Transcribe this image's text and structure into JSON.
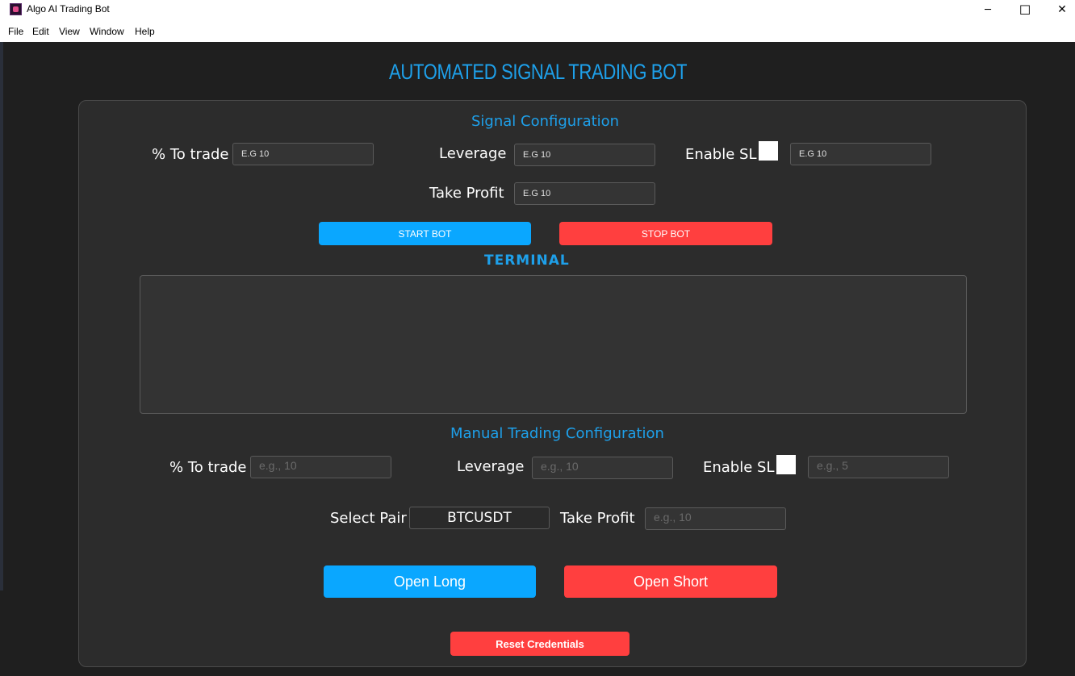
{
  "window": {
    "title": "Algo AI Trading Bot",
    "minimize": "─",
    "maximize": "☐",
    "close": "✕"
  },
  "menu": [
    "File",
    "Edit",
    "View",
    "Window",
    "Help"
  ],
  "app_title": "AUTOMATED SIGNAL TRADING BOT",
  "signal": {
    "title": "Signal Configuration",
    "pct_label": "% To trade",
    "pct_placeholder": "E.G 10",
    "leverage_label": "Leverage",
    "leverage_placeholder": "E.G 10",
    "sl_label": "Enable SL",
    "sl_placeholder": "E.G 10",
    "tp_label": "Take Profit",
    "tp_placeholder": "E.G 10",
    "start_label": "START BOT",
    "stop_label": "STOP BOT"
  },
  "terminal": {
    "title": "TERMINAL"
  },
  "manual": {
    "title": "Manual Trading Configuration",
    "pct_label": "% To trade",
    "pct_placeholder": "e.g., 10",
    "leverage_label": "Leverage",
    "leverage_placeholder": "e.g., 10",
    "sl_label": "Enable SL",
    "sl_placeholder": "e.g., 5",
    "pair_label": "Select Pair",
    "pair_value": "BTCUSDT",
    "tp_label": "Take Profit",
    "tp_placeholder": "e.g., 10",
    "long_label": "Open Long",
    "short_label": "Open Short"
  },
  "reset_label": "Reset Credentials",
  "colors": {
    "accent": "#1ea0ea",
    "button_blue": "#0aa7ff",
    "button_red": "#ff3f3f",
    "panel": "#2c2c2c",
    "background": "#1f1f1f"
  }
}
